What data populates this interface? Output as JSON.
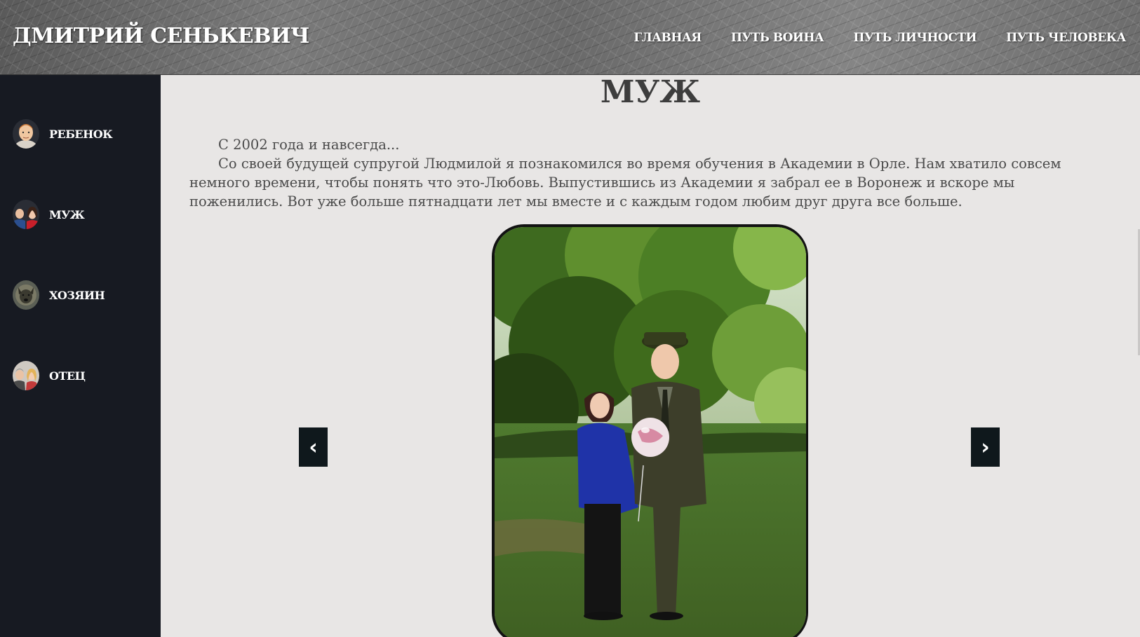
{
  "header": {
    "site_title": "ДМИТРИЙ СЕНЬКЕВИЧ",
    "nav": [
      "ГЛАВНАЯ",
      "ПУТЬ ВОИНА",
      "ПУТЬ ЛИЧНОСТИ",
      "ПУТЬ ЧЕЛОВЕКА"
    ]
  },
  "sidebar": {
    "items": [
      {
        "label": "РЕБЕНОК",
        "icon": "child-portrait-icon"
      },
      {
        "label": "МУЖ",
        "icon": "couple-portrait-icon"
      },
      {
        "label": "ХОЗЯИН",
        "icon": "dog-portrait-icon"
      },
      {
        "label": "ОТЕЦ",
        "icon": "family-portrait-icon"
      }
    ]
  },
  "main": {
    "title": "МУЖ",
    "paragraphs": [
      "С 2002 года и навсегда...",
      "Со своей будущей супругой Людмилой я познакомился во время обучения в Академии в Орле. Нам хватило совсем немного времени, чтобы понять что это-Любовь. Выпустившись из Академии я забрал ее в Воронеж и вскоре мы поженились. Вот уже больше пятнадцати лет мы вместе и с каждым годом любим друг друга все больше."
    ],
    "carousel": {
      "prev_label": "‹",
      "next_label": "›"
    }
  }
}
